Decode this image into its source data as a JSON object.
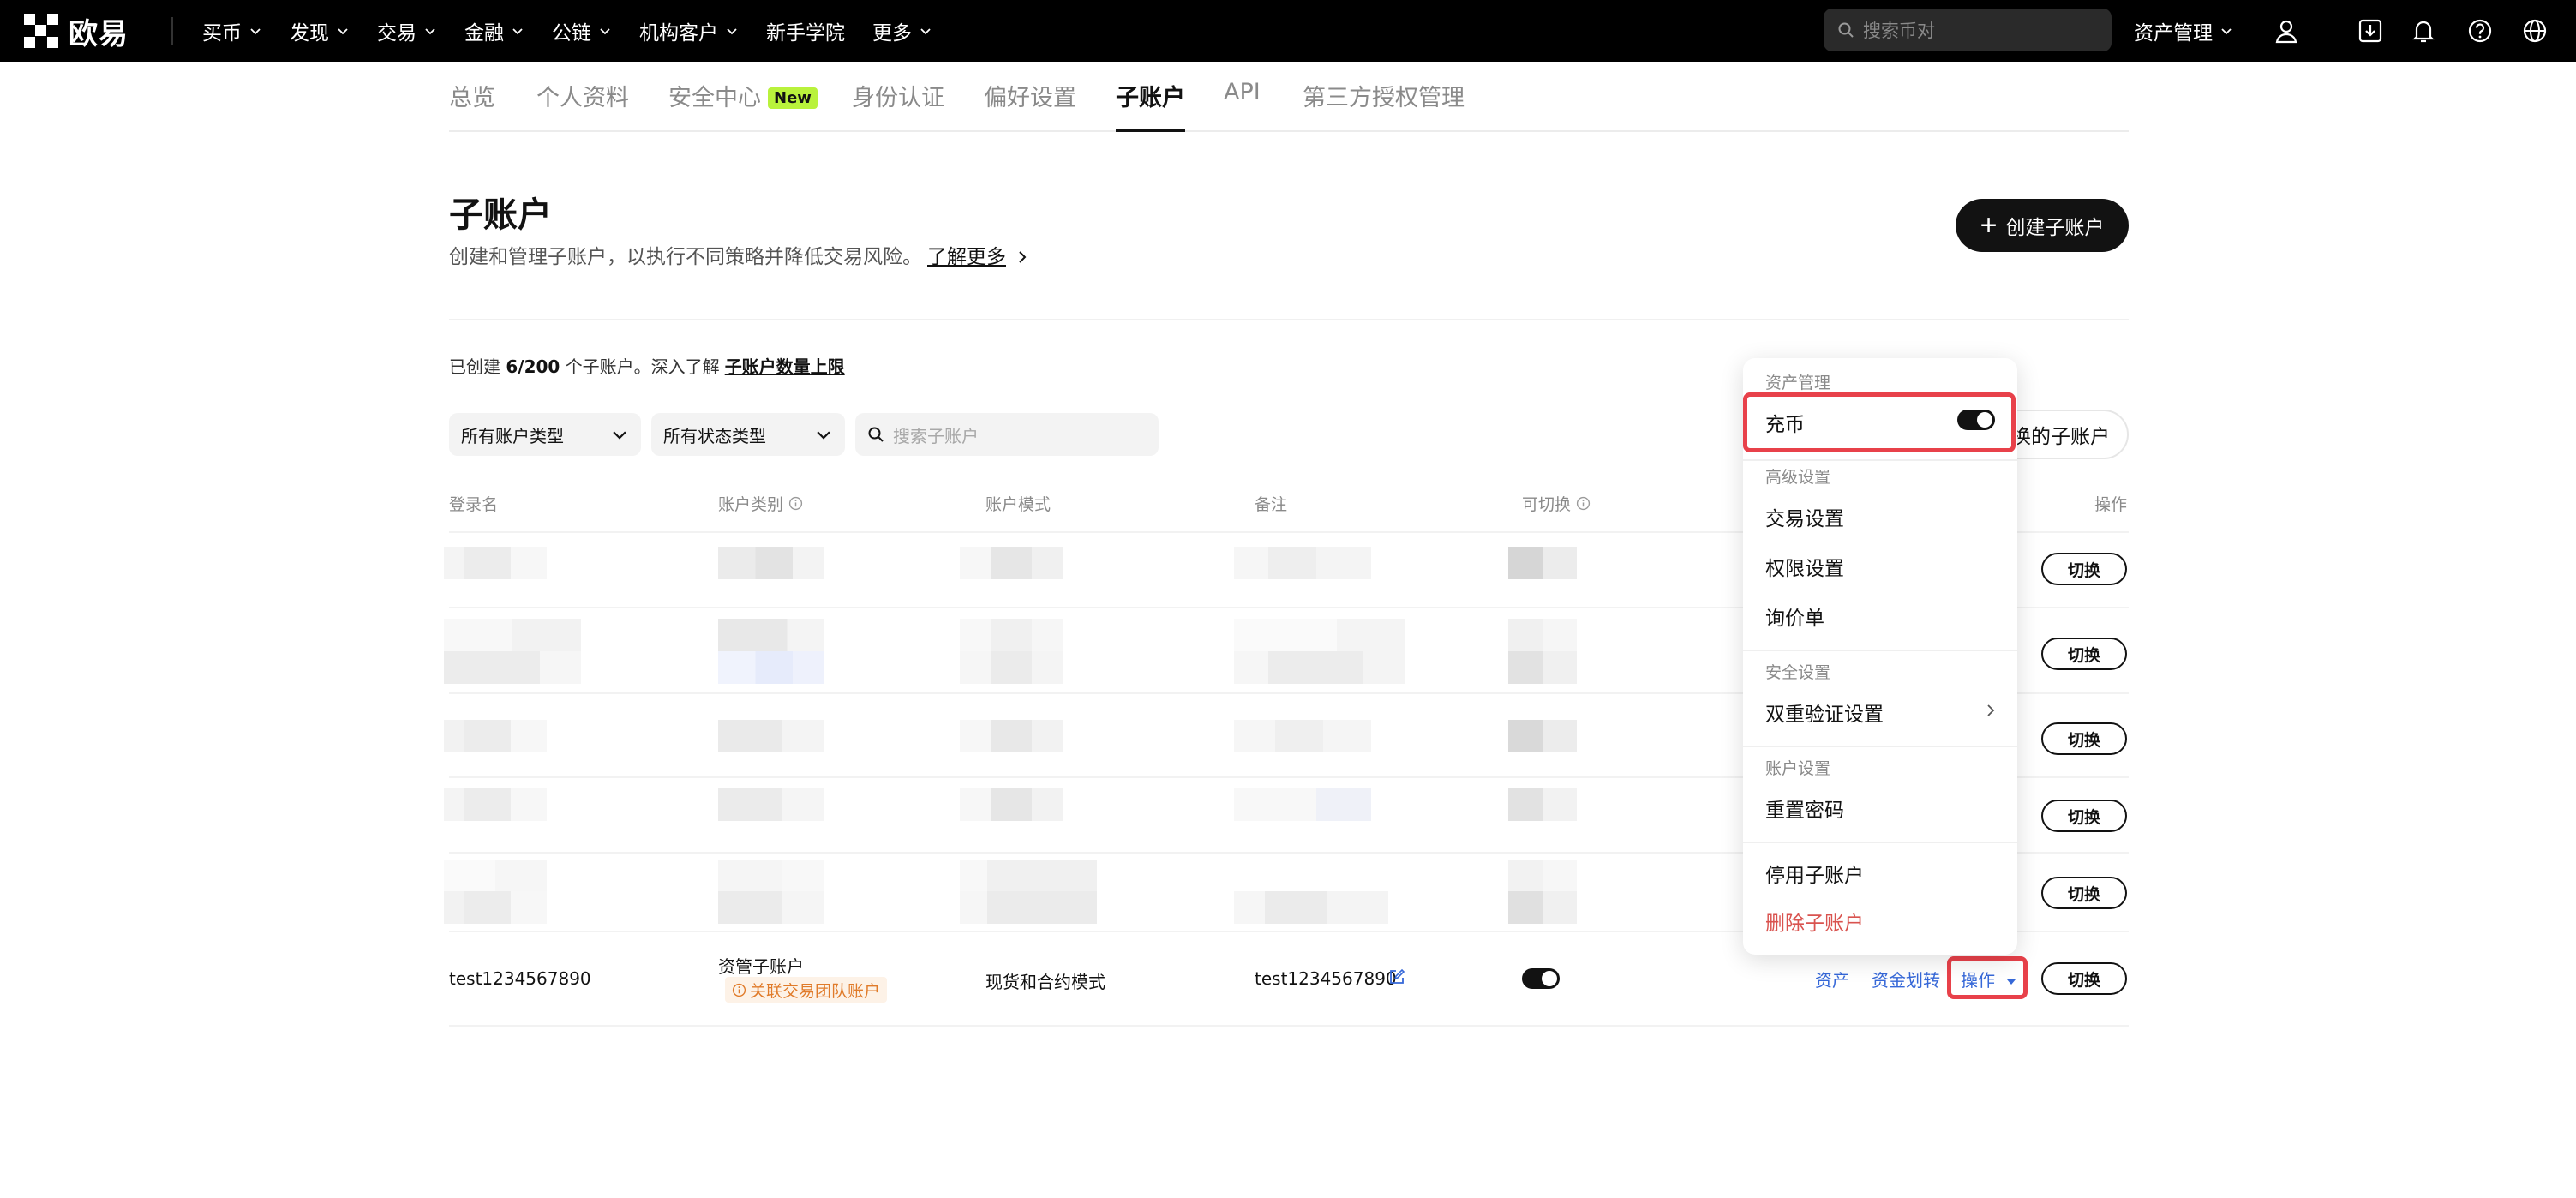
{
  "nav": {
    "logo": "欧易",
    "items": [
      {
        "label": "买币"
      },
      {
        "label": "发现"
      },
      {
        "label": "交易"
      },
      {
        "label": "金融"
      },
      {
        "label": "公链"
      },
      {
        "label": "机构客户"
      },
      {
        "label": "新手学院"
      },
      {
        "label": "更多"
      }
    ],
    "search_placeholder": "搜索币对",
    "asset_management": "资产管理"
  },
  "tabs": [
    {
      "label": "总览"
    },
    {
      "label": "个人资料"
    },
    {
      "label": "安全中心",
      "badge": "New"
    },
    {
      "label": "身份认证"
    },
    {
      "label": "偏好设置"
    },
    {
      "label": "子账户",
      "active": true
    },
    {
      "label": "API"
    },
    {
      "label": "第三方授权管理"
    }
  ],
  "header": {
    "title": "子账户",
    "subtitle": "创建和管理子账户，以执行不同策略并降低交易风险。",
    "learn_more": "了解更多",
    "create_button": "创建子账户"
  },
  "summary": {
    "prefix": "已创建",
    "count": "6/200",
    "suffix": "个子账户。深入了解",
    "link": "子账户数量上限"
  },
  "filters": {
    "account_type": "所有账户类型",
    "status_type": "所有状态类型",
    "search_placeholder": "搜索子账户",
    "switch_label": "换的子账户"
  },
  "table": {
    "headers": {
      "login": "登录名",
      "type": "账户类别",
      "mode": "账户模式",
      "note": "备注",
      "switchable": "可切换",
      "actions": "操作"
    },
    "switch_button": "切换",
    "row": {
      "login": "test1234567890",
      "type": "资管子账户",
      "tag": "关联交易团队账户",
      "mode": "现货和合约模式",
      "note": "test1234567890",
      "switchable": true,
      "link_assets": "资产",
      "link_transfer": "资金划转",
      "link_ops": "操作"
    }
  },
  "menu": {
    "sec_asset": "资产管理",
    "deposit": "充币",
    "deposit_enabled": true,
    "sec_advanced": "高级设置",
    "trade_settings": "交易设置",
    "permission_settings": "权限设置",
    "rfq": "询价单",
    "sec_security": "安全设置",
    "two_factor": "双重验证设置",
    "sec_account": "账户设置",
    "reset_password": "重置密码",
    "disable_sub": "停用子账户",
    "delete_sub": "删除子账户"
  },
  "colors": {
    "accent_link": "#3668d8",
    "highlight": "#e8414a",
    "new_badge": "#b9f23c",
    "danger": "#d9534f"
  }
}
